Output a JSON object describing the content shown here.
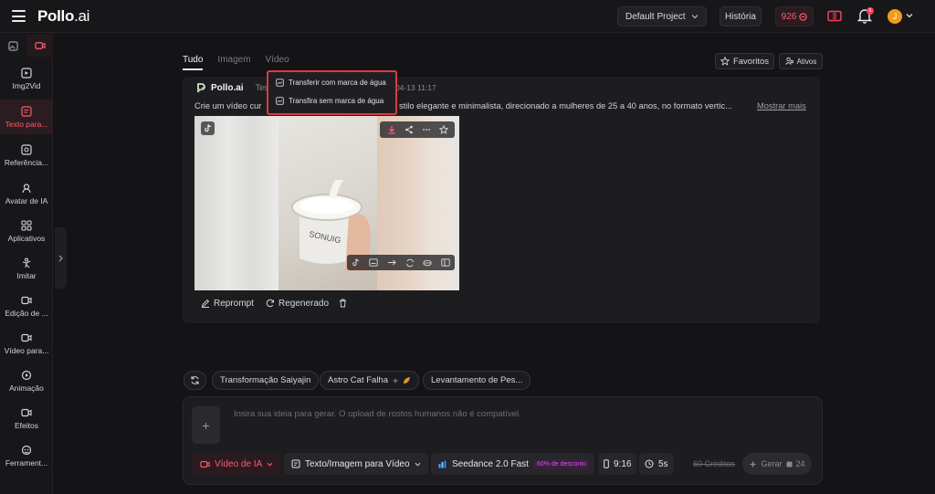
{
  "header": {
    "logo_brand": "Pollo",
    "logo_suffix": ".ai",
    "project": "Default Project",
    "history": "História",
    "credits": "926",
    "notification_count": "6",
    "avatar_initial": "J"
  },
  "sidebar": {
    "items": [
      {
        "label": "Img2Vid"
      },
      {
        "label": "Texto para..."
      },
      {
        "label": "Referência..."
      },
      {
        "label": "Avatar de IA"
      },
      {
        "label": "Aplicativos"
      },
      {
        "label": "Imitar"
      },
      {
        "label": "Edição de ..."
      },
      {
        "label": "Vídeo para..."
      },
      {
        "label": "Animação"
      },
      {
        "label": "Efeitos"
      },
      {
        "label": "Ferrament..."
      }
    ]
  },
  "main": {
    "tabs": [
      {
        "label": "Tudo"
      },
      {
        "label": "Imagem"
      },
      {
        "label": "Vídeo"
      }
    ],
    "favorites": "Favoritos",
    "assets": "Ativos",
    "card": {
      "brand": "Pollo.ai",
      "model_prefix": "Tes",
      "date": "04-13 11:17",
      "prompt_start": "Crie um vídeo cur",
      "prompt_end": "stilo elegante e minimalista, direcionado a mulheres de 25 a 40 anos, no formato vertic...",
      "show_more": "Mostrar mais",
      "jar_text": "SONUIG",
      "reprompt": "Reprompt",
      "regenerate": "Regenerado"
    },
    "download_menu": {
      "with_watermark": "Transferir com marca de água",
      "without_watermark": "Transfira sem marca de água"
    }
  },
  "suggestions": [
    {
      "label": "Transformação Saiyajin"
    },
    {
      "label": "Astro Cat Falha"
    },
    {
      "label": "Levantamento de Pes..."
    }
  ],
  "composer": {
    "placeholder": "Insira sua ideia para gerar. O upload de rostos humanos não é compatível.",
    "upload_plus": "+",
    "mode": "Vídeo de IA",
    "type": "Texto/Imagem para Vídeo",
    "model": "Seedance 2.0 Fast",
    "discount": "60% de desconto",
    "ratio": "9:16",
    "duration": "5s",
    "old_credits": "60 Créditos",
    "generate": "Gerar",
    "generate_cost": "24"
  },
  "colors": {
    "accent": "#ff5a6e",
    "highlight_border": "#e0393e",
    "background": "#141416"
  }
}
